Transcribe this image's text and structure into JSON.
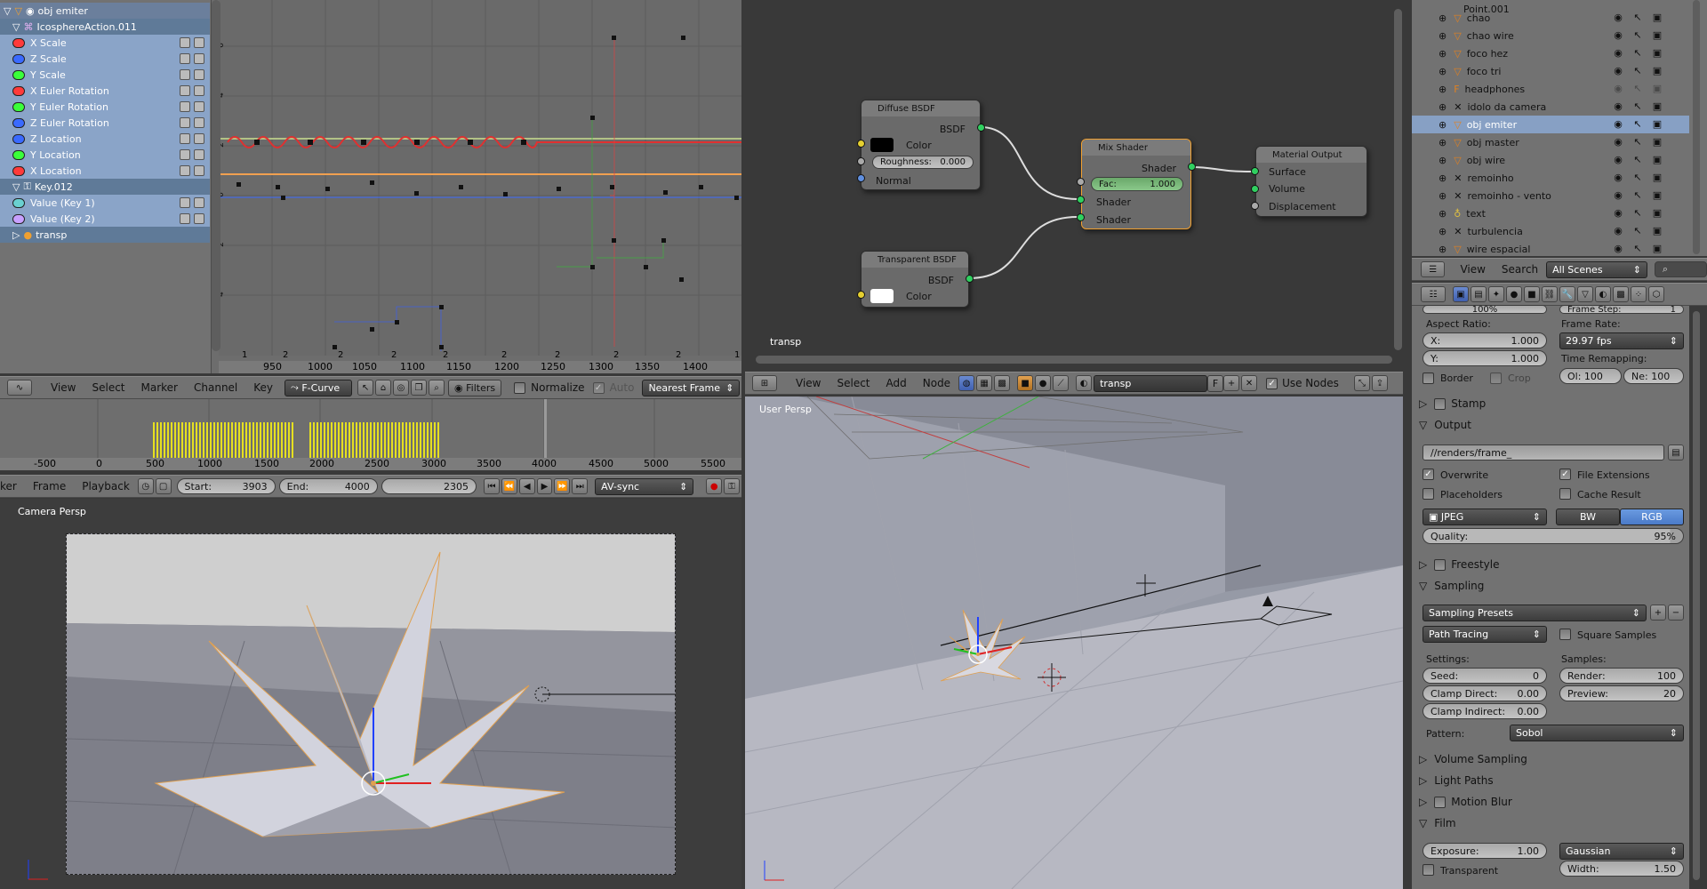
{
  "graph_editor": {
    "channels": [
      {
        "label": "obj emiter",
        "type": "object"
      },
      {
        "label": "IcosphereAction.011",
        "type": "action"
      },
      {
        "label": "X Scale",
        "color": "#ff3a3a"
      },
      {
        "label": "Z Scale",
        "color": "#3a6aff"
      },
      {
        "label": "Y Scale",
        "color": "#3aff3a"
      },
      {
        "label": "X Euler Rotation",
        "color": "#ff3a3a"
      },
      {
        "label": "Y Euler Rotation",
        "color": "#3aff3a"
      },
      {
        "label": "Z Euler Rotation",
        "color": "#3a6aff"
      },
      {
        "label": "Z Location",
        "color": "#3a6aff"
      },
      {
        "label": "Y Location",
        "color": "#3aff3a"
      },
      {
        "label": "X Location",
        "color": "#ff3a3a"
      },
      {
        "label": "Key.012",
        "type": "key"
      },
      {
        "label": "Value (Key 1)",
        "color": "#6ad0d0"
      },
      {
        "label": "Value (Key 2)",
        "color": "#c8a0ff"
      },
      {
        "label": "transp",
        "type": "material"
      }
    ],
    "y_ticks": [
      "6",
      "4",
      "2",
      "0",
      "2",
      "4"
    ],
    "x_ticks": [
      "950",
      "1000",
      "1050",
      "1100",
      "1150",
      "1200",
      "1250",
      "1300",
      "1350",
      "1400"
    ],
    "bottom_markers": [
      "1",
      "2",
      "2",
      "2",
      "2",
      "2",
      "2",
      "2",
      "2",
      "1"
    ],
    "menus": [
      "View",
      "Select",
      "Marker",
      "Channel",
      "Key"
    ],
    "mode": "F-Curve",
    "filters_label": "Filters",
    "normalize_label": "Normalize",
    "auto_label": "Auto",
    "snap_mode": "Nearest Frame"
  },
  "timeline": {
    "ticks": [
      "-500",
      "0",
      "500",
      "1000",
      "1500",
      "2000",
      "2500",
      "3000",
      "3500",
      "4000",
      "4500",
      "5000",
      "5500"
    ],
    "menus": [
      "ker",
      "Frame",
      "Playback"
    ],
    "start_label": "Start:",
    "start_value": "3903",
    "end_label": "End:",
    "end_value": "4000",
    "current_frame": "2305",
    "sync": "AV-sync"
  },
  "camera_view": {
    "label": "Camera Persp"
  },
  "node_editor": {
    "nodes": {
      "diffuse": {
        "title": "Diffuse BSDF",
        "out": "BSDF",
        "color_label": "Color",
        "roughness": "Roughness:",
        "roughness_value": "0.000",
        "normal": "Normal"
      },
      "transparent": {
        "title": "Transparent BSDF",
        "out": "BSDF",
        "color_label": "Color"
      },
      "mix": {
        "title": "Mix Shader",
        "out": "Shader",
        "fac": "Fac:",
        "fac_value": "1.000",
        "in1": "Shader",
        "in2": "Shader"
      },
      "output": {
        "title": "Material Output",
        "surface": "Surface",
        "volume": "Volume",
        "displacement": "Displacement"
      }
    },
    "material_label": "transp",
    "menus": [
      "View",
      "Select",
      "Add",
      "Node"
    ],
    "material_field": "transp",
    "fake_user": "F",
    "use_nodes": "Use Nodes"
  },
  "viewport_3d": {
    "label": "User Persp"
  },
  "outliner": {
    "rows": [
      {
        "name": "Point.001"
      },
      {
        "name": "chao"
      },
      {
        "name": "chao wire"
      },
      {
        "name": "foco hez"
      },
      {
        "name": "foco tri"
      },
      {
        "name": "headphones"
      },
      {
        "name": "idolo da camera"
      },
      {
        "name": "obj emiter",
        "selected": true
      },
      {
        "name": "obj master"
      },
      {
        "name": "obj wire"
      },
      {
        "name": "remoinho"
      },
      {
        "name": "remoinho - vento"
      },
      {
        "name": "text"
      },
      {
        "name": "turbulencia"
      },
      {
        "name": "wire espacial"
      }
    ],
    "menus": [
      "View",
      "Search"
    ],
    "scene_filter": "All Scenes"
  },
  "properties": {
    "top_value": "100%",
    "frame_step": "Frame Step:",
    "frame_step_value": "1",
    "aspect_ratio": "Aspect Ratio:",
    "frame_rate": "Frame Rate:",
    "x_label": "X:",
    "x_value": "1.000",
    "y_label": "Y:",
    "y_value": "1.000",
    "fps": "29.97 fps",
    "time_remapping": "Time Remapping:",
    "old_label": "Ol: 100",
    "new_label": "Ne: 100",
    "border": "Border",
    "crop": "Crop",
    "stamp": "Stamp",
    "output": "Output",
    "output_path": "//renders/frame_",
    "overwrite": "Overwrite",
    "file_extensions": "File Extensions",
    "placeholders": "Placeholders",
    "cache_result": "Cache Result",
    "format": "JPEG",
    "bw": "BW",
    "rgb": "RGB",
    "quality_label": "Quality:",
    "quality_value": "95%",
    "freestyle": "Freestyle",
    "sampling": "Sampling",
    "sampling_presets": "Sampling Presets",
    "integrator": "Path Tracing",
    "square_samples": "Square Samples",
    "settings": "Settings:",
    "samples": "Samples:",
    "seed_label": "Seed:",
    "seed_value": "0",
    "render_label": "Render:",
    "render_value": "100",
    "clamp_direct_label": "Clamp Direct:",
    "clamp_direct_value": "0.00",
    "preview_label": "Preview:",
    "preview_value": "20",
    "clamp_indirect_label": "Clamp Indirect:",
    "clamp_indirect_value": "0.00",
    "pattern_label": "Pattern:",
    "pattern_value": "Sobol",
    "volume_sampling": "Volume Sampling",
    "light_paths": "Light Paths",
    "motion_blur": "Motion Blur",
    "film": "Film",
    "exposure_label": "Exposure:",
    "exposure_value": "1.00",
    "filter": "Gaussian",
    "transparent": "Transparent",
    "width_label": "Width:",
    "width_value": "1.50"
  }
}
